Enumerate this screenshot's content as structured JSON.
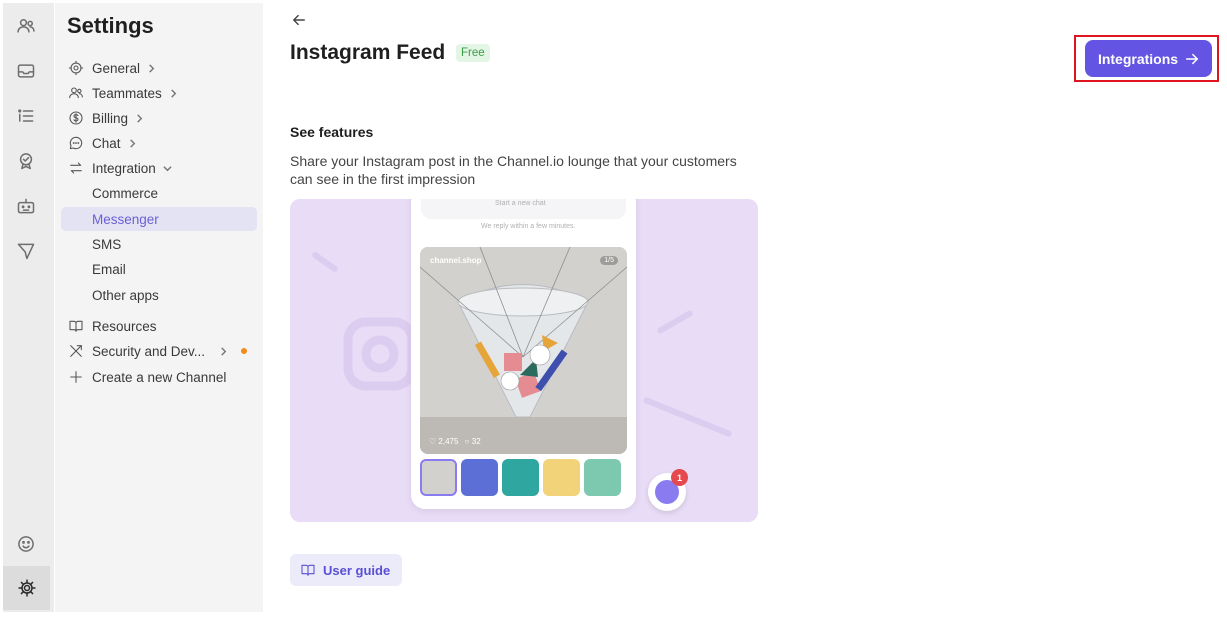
{
  "sidebar": {
    "title": "Settings",
    "items": [
      {
        "label": "General",
        "icon": "gear-icon"
      },
      {
        "label": "Teammates",
        "icon": "people-icon"
      },
      {
        "label": "Billing",
        "icon": "dollar-icon"
      },
      {
        "label": "Chat",
        "icon": "chat-bubble-icon"
      },
      {
        "label": "Integration",
        "icon": "swap-arrows-icon"
      }
    ],
    "integration_subitems": [
      {
        "label": "Commerce"
      },
      {
        "label": "Messenger"
      },
      {
        "label": "SMS"
      },
      {
        "label": "Email"
      },
      {
        "label": "Other apps"
      }
    ],
    "bottom_items": [
      {
        "label": "Resources",
        "icon": "book-icon"
      },
      {
        "label": "Security and Dev...",
        "icon": "tools-icon"
      },
      {
        "label": "Create a new Channel",
        "icon": "plus-icon"
      }
    ]
  },
  "rail": {
    "icons": [
      "people-icon",
      "inbox-icon",
      "list-icon",
      "badge-icon",
      "bot-icon",
      "send-icon",
      "smiley-icon",
      "settings-icon"
    ]
  },
  "main": {
    "title": "Instagram Feed",
    "badge": "Free",
    "integrations_label": "Integrations",
    "section_title": "See features",
    "description": "Share your Instagram post in the Channel.io lounge that your customers can see in the first impression",
    "guide_label": "User guide"
  },
  "preview": {
    "start_chat": "Start a new chat",
    "reply_note": "We reply within a few minutes.",
    "handle": "channel.shop",
    "counter": "1/5",
    "likes": "2,475",
    "comments": "32",
    "notification_count": "1"
  },
  "colors": {
    "accent": "#6354e3",
    "badge_bg": "#e3f5e4",
    "badge_text": "#3b9a48",
    "highlight": "#e0141f",
    "preview_bg": "#e8dcf6"
  }
}
